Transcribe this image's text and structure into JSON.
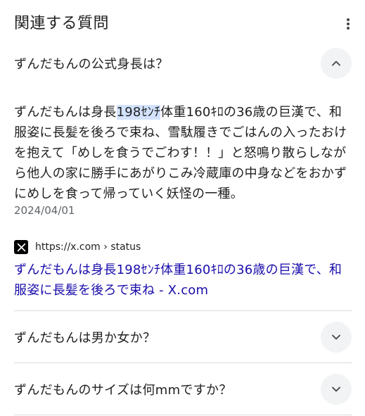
{
  "header": {
    "title": "関連する質問",
    "more_icon": "more-vert-icon"
  },
  "expanded": {
    "question": "ずんだもんの公式身長は？",
    "answer_before": "ずんだもんは身長",
    "answer_highlight": "198ｾﾝﾁ",
    "answer_after": "体重160ｷﾛの36歳の巨漢で、和服姿に長髪を後ろで束ね、雪駄履きでごはんの入ったおけを抱えて「めしを食うでごわす！！」と怒鳴り散らしながら他人の家に勝手にあがりこみ冷蔵庫の中身などをおかずにめしを食って帰っていく妖怪の一種。",
    "date": "2024/04/01",
    "source_url": "https://x.com › status",
    "source_icon": "x-logo-icon",
    "link_title": "ずんだもんは身長198ｾﾝﾁ体重160ｷﾛの36歳の巨漢で、和服姿に長髪を後ろで束ね - X.com",
    "link_color": "#1a0dab"
  },
  "questions": [
    {
      "text": "ずんだもんは男か女か？"
    },
    {
      "text": "ずんだもんのサイズは何mmですか？"
    }
  ],
  "highlight_color": "#d3e3fd"
}
